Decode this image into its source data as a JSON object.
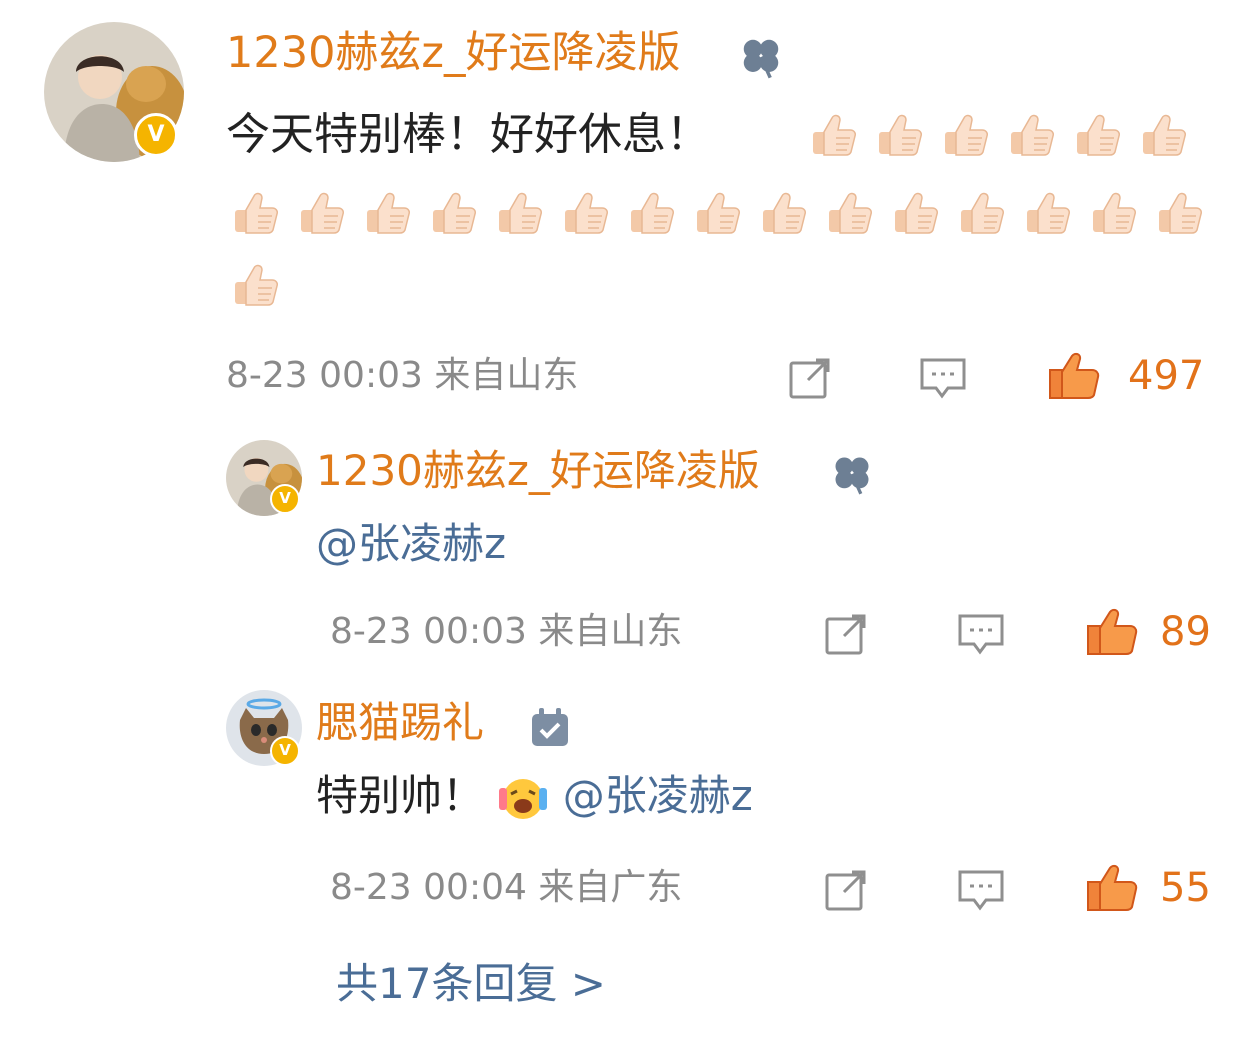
{
  "comment": {
    "username": "1230赫兹z_好运降凌版",
    "badge_icon": "clover-icon",
    "text": "今天特别棒！好好休息！",
    "thumbs_up_count": 22,
    "timestamp": "8-23 00:03",
    "location": "来自山东",
    "like_count": "497"
  },
  "replies": [
    {
      "username": "1230赫兹z_好运降凌版",
      "badge_icon": "clover-icon",
      "text": "",
      "mention": "@张凌赫z",
      "timestamp": "8-23 00:03",
      "location": "来自山东",
      "like_count": "89"
    },
    {
      "username": "腮猫踢礼",
      "badge_icon": "calendar-check-icon",
      "text": "特别帅！",
      "emoji": "crying-laughing-emoji",
      "mention": "@张凌赫z",
      "timestamp": "8-23 00:04",
      "location": "来自广东",
      "like_count": "55"
    }
  ],
  "more_replies": "共17条回复 >",
  "colors": {
    "username": "#e07b1a",
    "mention": "#4a6d96",
    "meta": "#8a8a8a",
    "like": "#e2721a",
    "verified": "#f5b400"
  }
}
